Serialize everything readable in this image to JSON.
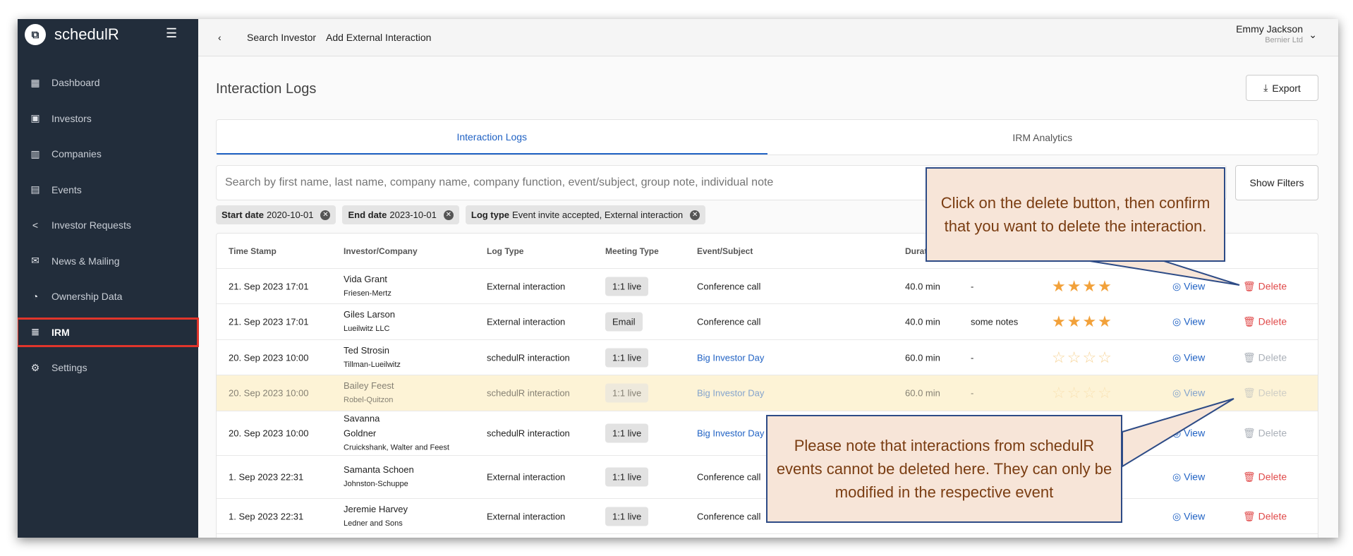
{
  "app": {
    "name": "schedulR"
  },
  "sidebar": {
    "items": [
      {
        "label": "Dashboard",
        "icon": "grid-icon"
      },
      {
        "label": "Investors",
        "icon": "id-badge-icon"
      },
      {
        "label": "Companies",
        "icon": "building-icon"
      },
      {
        "label": "Events",
        "icon": "calendar-icon"
      },
      {
        "label": "Investor Requests",
        "icon": "share-icon"
      },
      {
        "label": "News & Mailing",
        "icon": "mail-icon"
      },
      {
        "label": "Ownership Data",
        "icon": "pie-icon"
      },
      {
        "label": "IRM",
        "icon": "notes-icon",
        "active": true
      },
      {
        "label": "Settings",
        "icon": "gear-icon"
      }
    ]
  },
  "topbar": {
    "back": "‹",
    "links": [
      "Search Investor",
      "Add External Interaction"
    ],
    "user_name": "Emmy Jackson",
    "user_company": "Bernier Ltd"
  },
  "page": {
    "title": "Interaction Logs",
    "export": "Export",
    "tabs": [
      "Interaction Logs",
      "IRM Analytics"
    ],
    "search_placeholder": "Search by first name, last name, company name, company function, event/subject, group note, individual note",
    "show_filters": "Show Filters"
  },
  "filters": [
    {
      "label": "Start date",
      "value": "2020-10-01"
    },
    {
      "label": "End date",
      "value": "2023-10-01"
    },
    {
      "label": "Log type",
      "value": "Event invite accepted, External interaction"
    }
  ],
  "table": {
    "headers": [
      "Time Stamp",
      "Investor/Company",
      "Log Type",
      "Meeting Type",
      "Event/Subject",
      "Durat"
    ],
    "view_label": "View",
    "delete_label": "Delete",
    "rows": [
      {
        "time": "21. Sep 2023 17:01",
        "investor": "Vida Grant",
        "company": "Friesen-Mertz",
        "log_type": "External interaction",
        "meeting": "1:1 live",
        "event": "Conference call",
        "event_link": false,
        "duration": "40.0 min",
        "notes": "-",
        "rating": 4,
        "deletable": true
      },
      {
        "time": "21. Sep 2023 17:01",
        "investor": "Giles Larson",
        "company": "Lueilwitz LLC",
        "log_type": "External interaction",
        "meeting": "Email",
        "event": "Conference call",
        "event_link": false,
        "duration": "40.0 min",
        "notes": "some notes",
        "rating": 4,
        "deletable": true
      },
      {
        "time": "20. Sep 2023 10:00",
        "investor": "Ted Strosin",
        "company": "Tillman-Lueilwitz",
        "log_type": "schedulR interaction",
        "meeting": "1:1 live",
        "event": "Big Investor Day",
        "event_link": true,
        "duration": "60.0 min",
        "notes": "-",
        "rating": 0,
        "deletable": false
      },
      {
        "time": "20. Sep 2023 10:00",
        "investor": "Bailey Feest",
        "company": "Robel-Quitzon",
        "log_type": "schedulR interaction",
        "meeting": "1:1 live",
        "event": "Big Investor Day",
        "event_link": true,
        "duration": "60.0 min",
        "notes": "-",
        "rating": 0,
        "deletable": false,
        "highlighted": true
      },
      {
        "time": "20. Sep 2023 10:00",
        "investor": "Savanna Goldner",
        "company": "Cruickshank, Walter and Feest",
        "log_type": "schedulR interaction",
        "meeting": "1:1 live",
        "event": "Big Investor Day",
        "event_link": true,
        "duration": "",
        "notes": "",
        "rating": null,
        "deletable": false
      },
      {
        "time": "1. Sep 2023 22:31",
        "investor": "Samanta Schoen",
        "company": "Johnston-Schuppe",
        "log_type": "External interaction",
        "meeting": "1:1 live",
        "event": "Conference call",
        "event_link": false,
        "duration": "",
        "notes": "",
        "rating": null,
        "deletable": true
      },
      {
        "time": "1. Sep 2023 22:31",
        "investor": "Jeremie Harvey",
        "company": "Ledner and Sons",
        "log_type": "External interaction",
        "meeting": "1:1 live",
        "event": "Conference call",
        "event_link": false,
        "duration": "",
        "notes": "",
        "rating": null,
        "deletable": true
      }
    ]
  },
  "callouts": {
    "delete": "Click on the delete button, then confirm that you want to delete the interaction.",
    "note": "Please note that interactions from schedulR events cannot be deleted here. They can only be modified in the respective event"
  },
  "colors": {
    "sidebar": "#222d3b",
    "accent": "#2062c4",
    "delete": "#e04a4a",
    "star": "#f2a13a",
    "highlight": "#fdf3d6",
    "callout_bg": "#f7e5d8",
    "callout_border": "#2d4b86",
    "active_outline": "#e0352b"
  }
}
